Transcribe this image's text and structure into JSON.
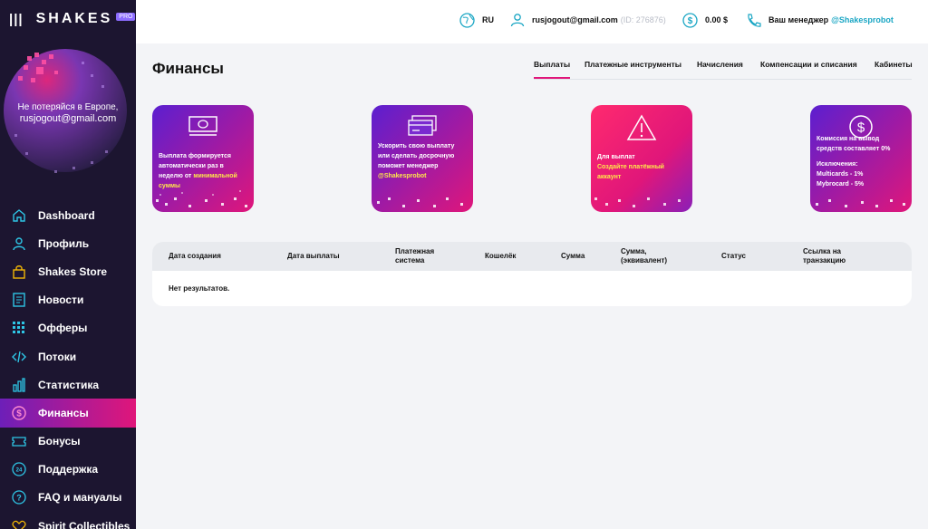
{
  "sidebar": {
    "logo": "SHAKES",
    "badge": "PRO",
    "promo_line1": "Не потеряйся в Европе,",
    "promo_line2": "rusjogout@gmail.com",
    "items": [
      {
        "label": "Dashboard",
        "icon": "home-icon"
      },
      {
        "label": "Профиль",
        "icon": "user-icon"
      },
      {
        "label": "Shakes Store",
        "icon": "bag-icon"
      },
      {
        "label": "Новости",
        "icon": "news-icon"
      },
      {
        "label": "Офферы",
        "icon": "grid-icon"
      },
      {
        "label": "Потоки",
        "icon": "code-icon"
      },
      {
        "label": "Статистика",
        "icon": "bar-chart-icon"
      },
      {
        "label": "Финансы",
        "icon": "dollar-icon"
      },
      {
        "label": "Бонусы",
        "icon": "ticket-icon"
      },
      {
        "label": "Поддержка",
        "icon": "support-icon"
      },
      {
        "label": "FAQ и мануалы",
        "icon": "question-icon"
      },
      {
        "label": "Spirit Collectibles",
        "icon": "heart-icon"
      }
    ],
    "active_index": 7
  },
  "topbar": {
    "language": "RU",
    "email": "rusjogout@gmail.com",
    "user_id": "(ID: 276876)",
    "balance": "0.00 $",
    "manager_label": "Ваш менеджер",
    "manager_handle": "@Shakesprobot"
  },
  "page": {
    "title": "Финансы",
    "tabs": [
      "Выплаты",
      "Платежные инструменты",
      "Начисления",
      "Компенсации и списания",
      "Кабинеты"
    ],
    "active_tab": 0
  },
  "cards": [
    {
      "icon": "banknote-icon",
      "t1": "Выплата формируется автоматически раз в неделю от ",
      "hl": "минимальной суммы",
      "t2": ""
    },
    {
      "icon": "cards-icon",
      "t1": "Ускорить свою выплату или сделать досрочную поможет менеджер ",
      "hl": "@Shakesprobot",
      "t2": ""
    },
    {
      "icon": "warning-icon",
      "t1": "Для выплат ",
      "hl": "Создайте платёжный аккаунт",
      "t2": ""
    },
    {
      "icon": "dollar-circle-icon",
      "t1": "Комиссия на вывод средств составляет 0%",
      "ex1": "Исключения:",
      "ex2": "Multicards - 1%",
      "ex3": "Mybrocard - 5%"
    }
  ],
  "table": {
    "columns": [
      "Дата создания",
      "Дата выплаты",
      "Платежная система",
      "Кошелёк",
      "Сумма",
      "Сумма, (эквивалент)",
      "Статус",
      "Ссылка на транзакцию"
    ],
    "empty_text": "Нет результатов."
  },
  "colors": {
    "accent": "#e0167a",
    "purple": "#6d1fb8",
    "link": "#1aa6c4",
    "sidebar": "#1c1530"
  }
}
